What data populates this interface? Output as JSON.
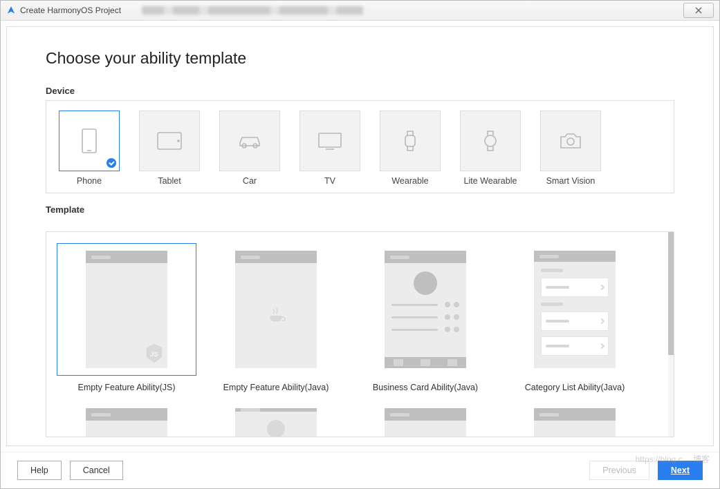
{
  "window": {
    "title": "Create HarmonyOS Project"
  },
  "page": {
    "heading": "Choose your ability template",
    "section_device": "Device",
    "section_template": "Template"
  },
  "devices": [
    {
      "id": "phone",
      "label": "Phone",
      "selected": true
    },
    {
      "id": "tablet",
      "label": "Tablet",
      "selected": false
    },
    {
      "id": "car",
      "label": "Car",
      "selected": false
    },
    {
      "id": "tv",
      "label": "TV",
      "selected": false
    },
    {
      "id": "wearable",
      "label": "Wearable",
      "selected": false
    },
    {
      "id": "lite-wearable",
      "label": "Lite Wearable",
      "selected": false
    },
    {
      "id": "smart-vision",
      "label": "Smart Vision",
      "selected": false
    }
  ],
  "templates": [
    {
      "id": "empty-js",
      "label": "Empty Feature Ability(JS)",
      "selected": true,
      "kind": "js"
    },
    {
      "id": "empty-java",
      "label": "Empty Feature Ability(Java)",
      "selected": false,
      "kind": "java"
    },
    {
      "id": "biz-card",
      "label": "Business Card Ability(Java)",
      "selected": false,
      "kind": "biz"
    },
    {
      "id": "cat-list",
      "label": "Category List Ability(Java)",
      "selected": false,
      "kind": "cat"
    },
    {
      "id": "row2a",
      "label": "",
      "selected": false,
      "kind": "peek"
    },
    {
      "id": "row2b",
      "label": "",
      "selected": false,
      "kind": "peek"
    },
    {
      "id": "row2c",
      "label": "",
      "selected": false,
      "kind": "peek"
    },
    {
      "id": "row2d",
      "label": "",
      "selected": false,
      "kind": "peek"
    }
  ],
  "footer": {
    "help": "Help",
    "cancel": "Cancel",
    "previous": "Previous",
    "next": "Next"
  },
  "colors": {
    "accent": "#2a7ff0"
  }
}
